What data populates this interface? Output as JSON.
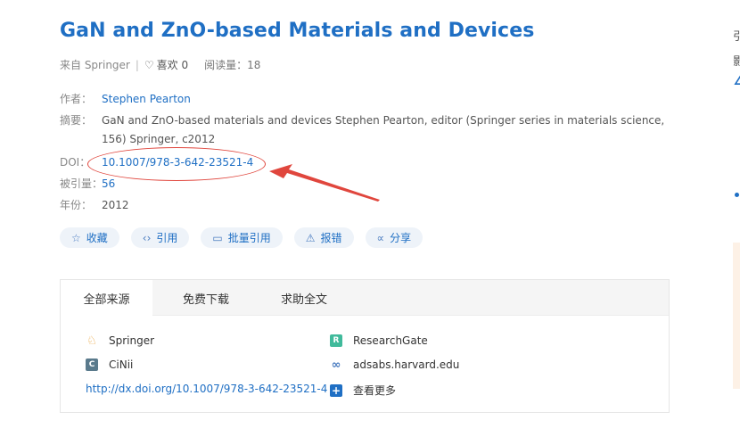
{
  "title": "GaN and ZnO-based Materials and Devices",
  "meta": {
    "source": "来自 Springer",
    "separator": "|",
    "like_label": "喜欢 0",
    "reads": "阅读量：18"
  },
  "fields": {
    "author_label": "作者：",
    "author_value": "Stephen Pearton",
    "abstract_label": "摘要：",
    "abstract_value": "GaN and ZnO-based materials and devices Stephen Pearton, editor (Springer series in materials science, 156) Springer, c2012",
    "doi_label": "DOI：",
    "doi_value": "10.1007/978-3-642-23521-4",
    "citations_label": "被引量：",
    "citations_value": "56",
    "year_label": "年份：",
    "year_value": "2012"
  },
  "actions": {
    "favorite": "收藏",
    "cite": "引用",
    "batch_cite": "批量引用",
    "report": "报错",
    "share": "分享"
  },
  "tabs": [
    "全部来源",
    "免费下载",
    "求助全文"
  ],
  "sources": {
    "springer": "Springer",
    "researchgate": "ResearchGate",
    "cinii": "CiNii",
    "adsabs": "adsabs.harvard.edu",
    "doi_link": "http://dx.doi.org/10.1007/978-3-642-23521-4",
    "more": "查看更多"
  },
  "right_panel": {
    "text1": "引",
    "text2": "影",
    "link_char": "∠"
  },
  "colors": {
    "primary": "#1f6fc4",
    "annotation_red": "#e0463d",
    "action_bg": "#eef3f9"
  },
  "icons": {
    "heart": "heart-icon",
    "star": "star-icon",
    "code": "code-icon",
    "folder": "folder-icon",
    "warning": "warning-icon",
    "share": "share-icon"
  }
}
